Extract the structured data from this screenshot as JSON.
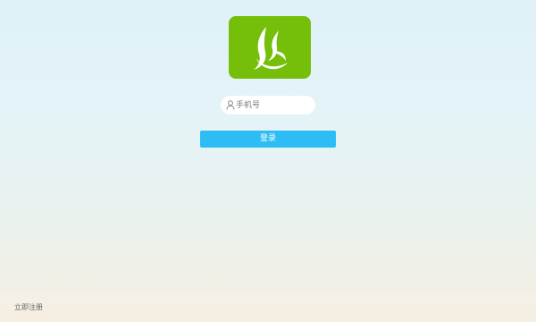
{
  "logo": {
    "icon": "green-flame-logo",
    "background_color": "#75bf0a"
  },
  "login_form": {
    "phone_placeholder": "手机号",
    "phone_value": "",
    "user_icon": "user-icon",
    "login_label": "登录",
    "login_button_color": "#2ebcf5"
  },
  "footer": {
    "register_label": "立即注册"
  }
}
